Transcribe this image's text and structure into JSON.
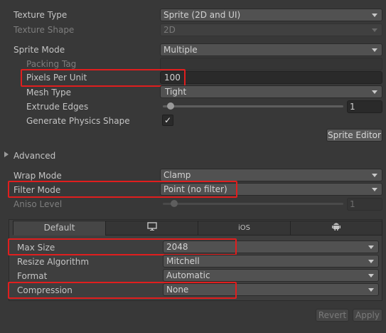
{
  "texture_type": {
    "label": "Texture Type",
    "value": "Sprite (2D and UI)"
  },
  "texture_shape": {
    "label": "Texture Shape",
    "value": "2D"
  },
  "sprite_mode": {
    "label": "Sprite Mode",
    "value": "Multiple"
  },
  "packing_tag": {
    "label": "Packing Tag",
    "value": ""
  },
  "pixels_per_unit": {
    "label": "Pixels Per Unit",
    "value": "100"
  },
  "mesh_type": {
    "label": "Mesh Type",
    "value": "Tight"
  },
  "extrude_edges": {
    "label": "Extrude Edges",
    "value": "1",
    "slider_fraction": 0.03
  },
  "generate_physics_shape": {
    "label": "Generate Physics Shape",
    "checked": true,
    "check_glyph": "✓"
  },
  "sprite_editor_button": "Sprite Editor",
  "advanced": {
    "label": "Advanced",
    "expanded": false
  },
  "wrap_mode": {
    "label": "Wrap Mode",
    "value": "Clamp"
  },
  "filter_mode": {
    "label": "Filter Mode",
    "value": "Point (no filter)"
  },
  "aniso_level": {
    "label": "Aniso Level",
    "value": "1",
    "slider_fraction": 0.06
  },
  "platform_tabs": [
    {
      "label": "Default",
      "active": true
    },
    {
      "label": "",
      "icon": "monitor-icon"
    },
    {
      "label": "iOS"
    },
    {
      "label": "",
      "icon": "android-icon"
    }
  ],
  "max_size": {
    "label": "Max Size",
    "value": "2048"
  },
  "resize_algorithm": {
    "label": "Resize Algorithm",
    "value": "Mitchell"
  },
  "format": {
    "label": "Format",
    "value": "Automatic"
  },
  "compression": {
    "label": "Compression",
    "value": "None"
  },
  "footer": {
    "revert": "Revert",
    "apply": "Apply"
  },
  "colors": {
    "highlight_box": "#e01e1e",
    "background": "#383838"
  }
}
